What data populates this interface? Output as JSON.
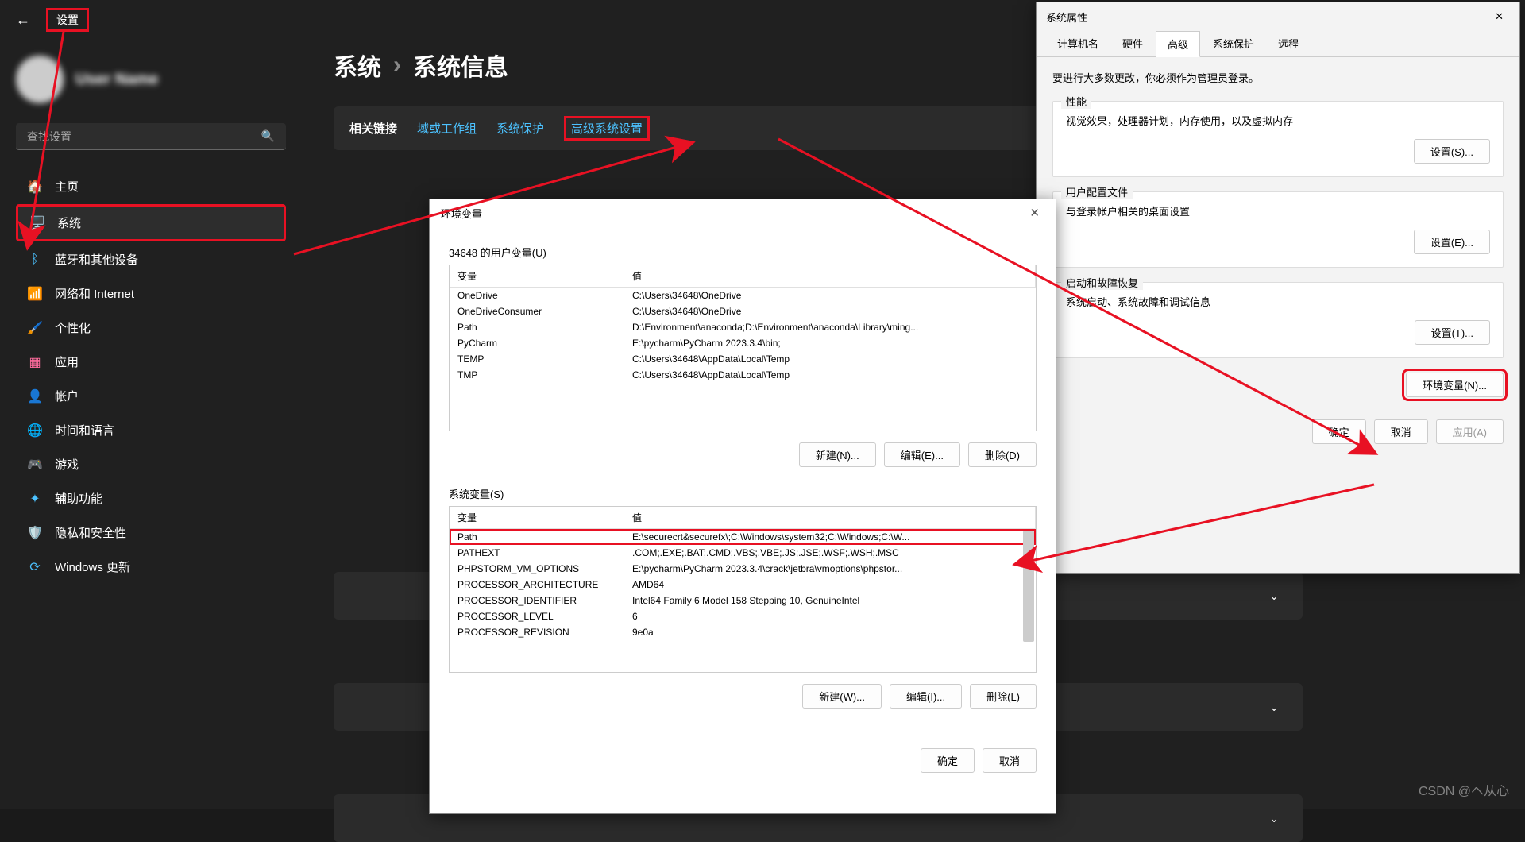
{
  "top": {
    "settings": "设置"
  },
  "user": {
    "name": "User Name"
  },
  "search": {
    "placeholder": "查找设置"
  },
  "nav": [
    {
      "icon": "🏠",
      "label": "主页",
      "color": "#fff"
    },
    {
      "icon": "🖥️",
      "label": "系统",
      "active": true,
      "color": "#4cc2ff"
    },
    {
      "icon": "ᛒ",
      "label": "蓝牙和其他设备",
      "color": "#4cc2ff"
    },
    {
      "icon": "📶",
      "label": "网络和 Internet",
      "color": "#4cc2ff"
    },
    {
      "icon": "🖌️",
      "label": "个性化",
      "color": "#ff8c00"
    },
    {
      "icon": "▦",
      "label": "应用",
      "color": "#ff6b9d"
    },
    {
      "icon": "👤",
      "label": "帐户",
      "color": "#6b8e23"
    },
    {
      "icon": "🌐",
      "label": "时间和语言",
      "color": "#4cc2ff"
    },
    {
      "icon": "🎮",
      "label": "游戏",
      "color": "#888"
    },
    {
      "icon": "✦",
      "label": "辅助功能",
      "color": "#4cc2ff"
    },
    {
      "icon": "🛡️",
      "label": "隐私和安全性",
      "color": "#ccc"
    },
    {
      "icon": "⟳",
      "label": "Windows 更新",
      "color": "#4cc2ff"
    }
  ],
  "breadcrumb": {
    "a": "系统",
    "sep": "›",
    "b": "系统信息"
  },
  "related": {
    "label": "相关链接",
    "links": [
      "域或工作组",
      "系统保护",
      "高级系统设置"
    ]
  },
  "sysprops": {
    "title": "系统属性",
    "tabs": [
      "计算机名",
      "硬件",
      "高级",
      "系统保护",
      "远程"
    ],
    "active_tab": 2,
    "note": "要进行大多数更改，你必须作为管理员登录。",
    "sections": [
      {
        "title": "性能",
        "text": "视觉效果，处理器计划，内存使用，以及虚拟内存",
        "btn": "设置(S)..."
      },
      {
        "title": "用户配置文件",
        "text": "与登录帐户相关的桌面设置",
        "btn": "设置(E)..."
      },
      {
        "title": "启动和故障恢复",
        "text": "系统启动、系统故障和调试信息",
        "btn": "设置(T)..."
      }
    ],
    "env_btn": "环境变量(N)...",
    "footer": {
      "ok": "确定",
      "cancel": "取消",
      "apply": "应用(A)"
    }
  },
  "env": {
    "title": "环境变量",
    "user_label": "34648 的用户变量(U)",
    "sys_label": "系统变量(S)",
    "col_var": "变量",
    "col_val": "值",
    "user_vars": [
      {
        "name": "OneDrive",
        "value": "C:\\Users\\34648\\OneDrive"
      },
      {
        "name": "OneDriveConsumer",
        "value": "C:\\Users\\34648\\OneDrive"
      },
      {
        "name": "Path",
        "value": "D:\\Environment\\anaconda;D:\\Environment\\anaconda\\Library\\ming..."
      },
      {
        "name": "PyCharm",
        "value": "E:\\pycharm\\PyCharm 2023.3.4\\bin;"
      },
      {
        "name": "TEMP",
        "value": "C:\\Users\\34648\\AppData\\Local\\Temp"
      },
      {
        "name": "TMP",
        "value": "C:\\Users\\34648\\AppData\\Local\\Temp"
      }
    ],
    "sys_vars": [
      {
        "name": "Path",
        "value": "E:\\securecrt&securefx\\;C:\\Windows\\system32;C:\\Windows;C:\\W...",
        "boxed": true
      },
      {
        "name": "PATHEXT",
        "value": ".COM;.EXE;.BAT;.CMD;.VBS;.VBE;.JS;.JSE;.WSF;.WSH;.MSC"
      },
      {
        "name": "PHPSTORM_VM_OPTIONS",
        "value": "E:\\pycharm\\PyCharm 2023.3.4\\crack\\jetbra\\vmoptions\\phpstor..."
      },
      {
        "name": "PROCESSOR_ARCHITECTURE",
        "value": "AMD64"
      },
      {
        "name": "PROCESSOR_IDENTIFIER",
        "value": "Intel64 Family 6 Model 158 Stepping 10, GenuineIntel"
      },
      {
        "name": "PROCESSOR_LEVEL",
        "value": "6"
      },
      {
        "name": "PROCESSOR_REVISION",
        "value": "9e0a"
      }
    ],
    "btns_user": {
      "new": "新建(N)...",
      "edit": "编辑(E)...",
      "del": "删除(D)"
    },
    "btns_sys": {
      "new": "新建(W)...",
      "edit": "编辑(I)...",
      "del": "删除(L)"
    },
    "footer": {
      "ok": "确定",
      "cancel": "取消"
    }
  },
  "watermark": "CSDN @ヘ从心"
}
